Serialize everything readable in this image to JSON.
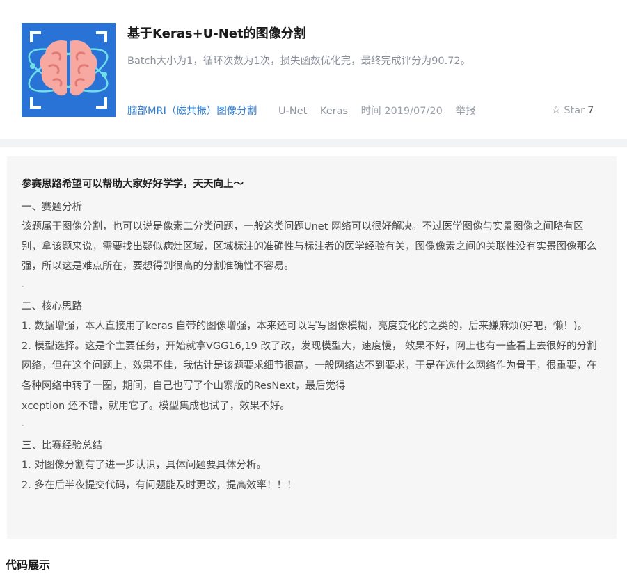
{
  "project": {
    "title": "基于Keras+U-Net的图像分割",
    "description": "Batch大小为1，循环次数为1次，损失函数优化完，最终完成评分为90.72。",
    "tags": {
      "category_link": "脑部MRI（磁共振）图像分割",
      "tag1": "U-Net",
      "tag2": "Keras"
    },
    "time": "时间 2019/07/20",
    "report": "举报",
    "star_label": "Star",
    "star_count": "7",
    "thumbnail_icon": "brain-scan-icon",
    "accent_color": "#2f7fd6",
    "thumbnail_bg": "#2a73d6"
  },
  "article": {
    "lead": "参赛思路希望可以帮助大家好好学学，天天向上～",
    "section1_title": "一、赛题分析",
    "section1_body": "该题属于图像分割，也可以说是像素二分类问题，一般这类问题Unet 网络可以很好解决。不过医学图像与实景图像之间略有区别，拿该题来说，需要找出疑似病灶区域，区域标注的准确性与标注者的医学经验有关，图像像素之间的关联性没有实景图像那么强，所以这是难点所在，要想得到很高的分割准确性不容易。",
    "dot1": "·",
    "section2_title": "二、核心思路",
    "section2_p1": "1. 数据增强，本人直接用了keras 自带的图像增强，本来还可以写写图像模糊，亮度变化的之类的，后来嫌麻烦(好吧，懒！)。",
    "section2_p2": "2. 模型选择。这是个主要任务，开始就拿VGG16,19 改了改，发现模型大，速度慢， 效果不好，网上也有一些看上去很好的分割网络，但在这个问题上，效果不佳，我估计是该题要求细节很高，一般网络达不到要求，于是在选什么网络作为骨干，很重要，在各种网络中转了一圈，期间，自己也写了个山寨版的ResNext，最后觉得",
    "section2_p3": "xception 还不错，就用它了。模型集成也试了，效果不好。",
    "dot2": "·",
    "section3_title": "三、比赛经验总结",
    "section3_p1": "1. 对图像分割有了进一步认识，具体问题要具体分析。",
    "section3_p2": "2. 多在后半夜提交代码，有问题能及时更改，提高效率！！！"
  },
  "code_section_title": "代码展示"
}
